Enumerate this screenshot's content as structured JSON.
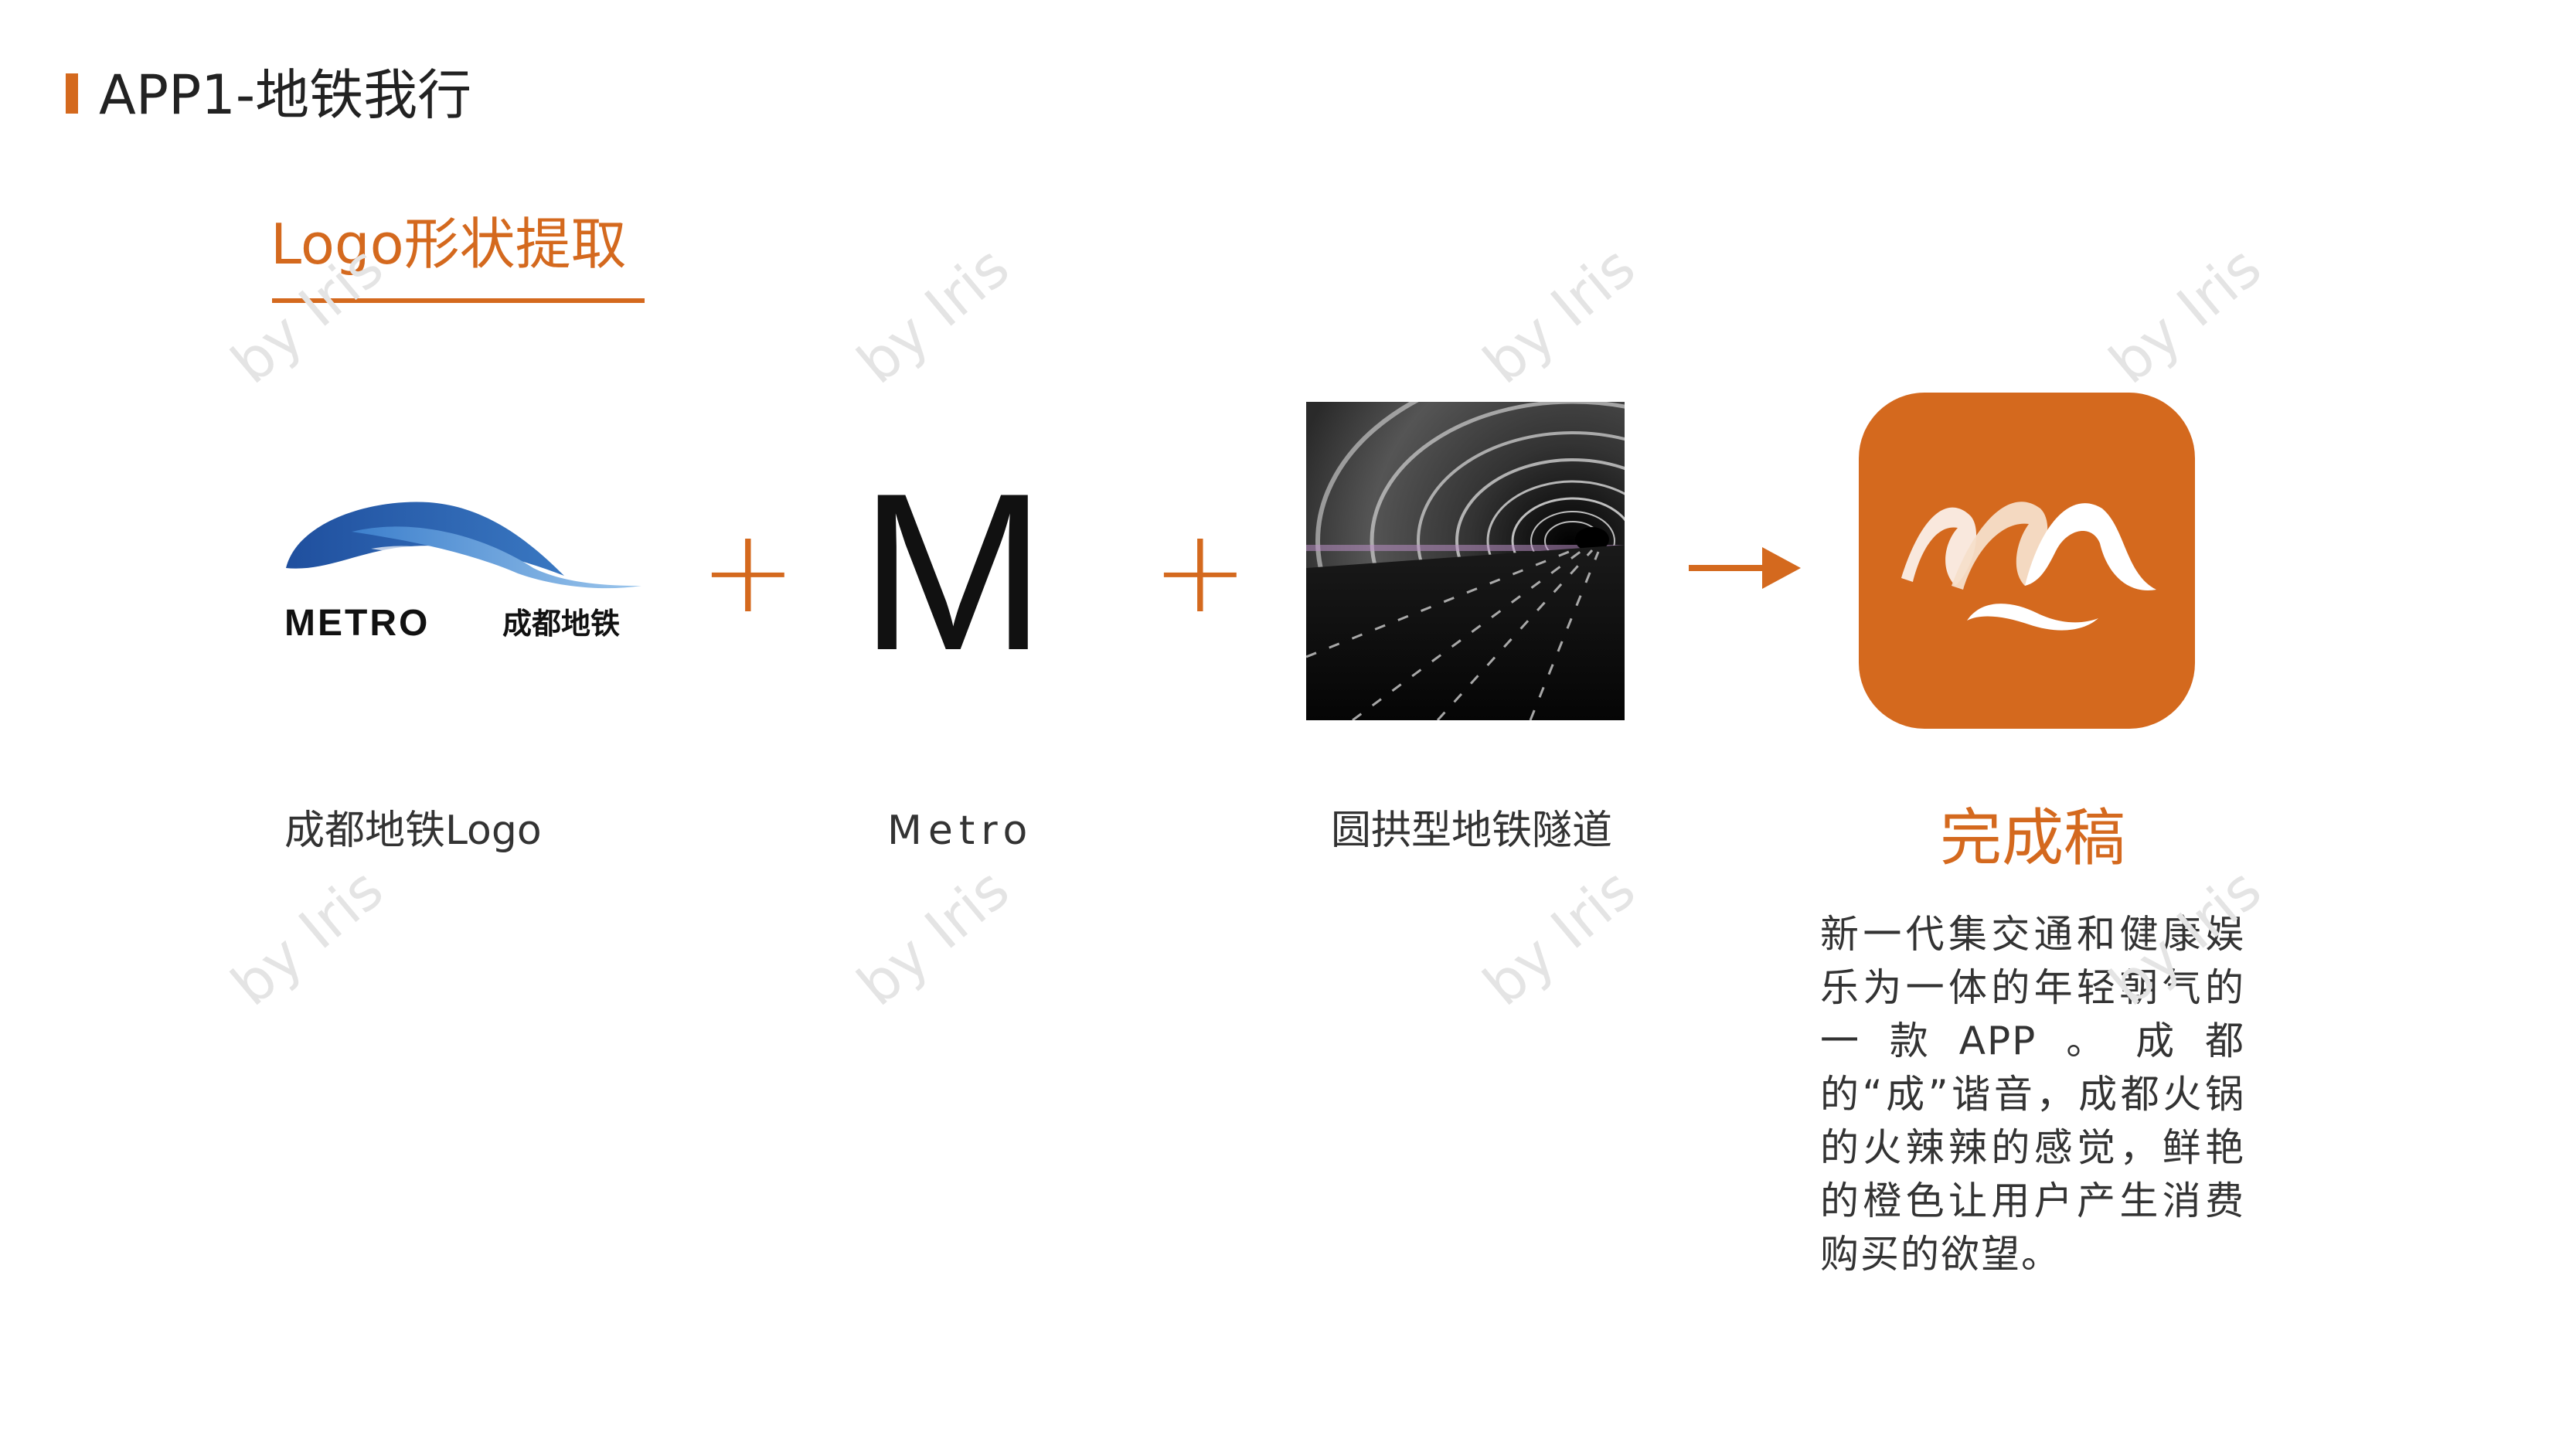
{
  "colors": {
    "accent": "#d4691e",
    "text": "#222222",
    "watermark": "#e4e4e4"
  },
  "header": {
    "title": "APP1-地铁我行"
  },
  "section": {
    "title": "Logo形状提取"
  },
  "items": [
    {
      "caption": "成都地铁Logo",
      "logo_text": "METRO",
      "logo_cn": "成都地铁"
    },
    {
      "caption": "Metro",
      "letter": "M"
    },
    {
      "caption": "圆拱型地铁隧道"
    }
  ],
  "operators": {
    "plus": "+"
  },
  "result": {
    "title": "完成稿",
    "description": "新一代集交通和健康娱乐为一体的年轻朝气的一款APP。成都的“成”谐音，成都火锅的火辣辣的感觉，鲜艳的橙色让用户产生消费购买的欲望。"
  },
  "watermark": {
    "text": "by Iris"
  }
}
